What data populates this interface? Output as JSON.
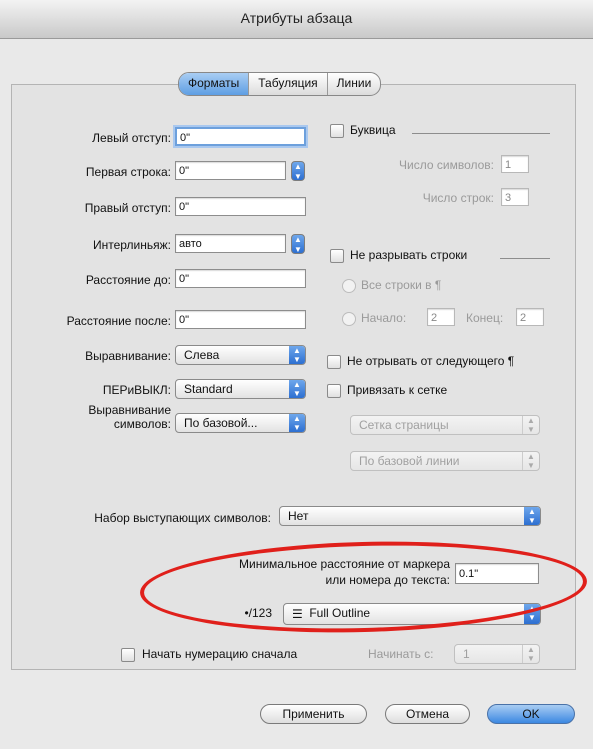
{
  "window": {
    "title": "Атрибуты абзаца"
  },
  "tabs": [
    {
      "label": "Форматы",
      "active": true
    },
    {
      "label": "Табуляция",
      "active": false
    },
    {
      "label": "Линии",
      "active": false
    }
  ],
  "fields": {
    "left_indent": {
      "label": "Левый отступ:",
      "value": "0\""
    },
    "first_line": {
      "label": "Первая строка:",
      "value": "0\""
    },
    "right_indent": {
      "label": "Правый отступ:",
      "value": "0\""
    },
    "leading": {
      "label": "Интерлиньяж:",
      "value": "авто"
    },
    "space_before": {
      "label": "Расстояние до:",
      "value": "0\""
    },
    "space_after": {
      "label": "Расстояние после:",
      "value": "0\""
    },
    "alignment": {
      "label": "Выравнивание:",
      "value": "Слева"
    },
    "hnj": {
      "label": "ПЕРиВЫКЛ:",
      "value": "Standard"
    },
    "char_align": {
      "label_line1": "Выравнивание",
      "label_line2": "символов:",
      "value": "По базовой..."
    },
    "hanging_chars": {
      "label": "Набор выступающих символов:",
      "value": "Нет"
    },
    "bullet_distance": {
      "label_line1": "Минимальное расстояние от маркера",
      "label_line2": "или номера до текста:",
      "value": "0.1\""
    },
    "numbering": {
      "label": "•/123",
      "value": "Full Outline"
    },
    "restart_numbering": {
      "label": "Начать нумерацию сначала"
    },
    "start_at": {
      "label": "Начинать с:",
      "value": "1"
    }
  },
  "drop_cap": {
    "label": "Буквица",
    "char_count_label": "Число символов:",
    "char_count": "1",
    "line_count_label": "Число строк:",
    "line_count": "3"
  },
  "keep_lines": {
    "label": "Не разрывать строки",
    "all_lines_label": "Все строки в ¶",
    "start_label": "Начало:",
    "start": "2",
    "end_label": "Конец:",
    "end": "2"
  },
  "keep_with_next": {
    "label": "Не отрывать от следующего ¶"
  },
  "lock_to_grid": {
    "label": "Привязать к сетке",
    "grid_type": "Сетка страницы",
    "baseline": "По базовой линии"
  },
  "buttons": {
    "apply": "Применить",
    "cancel": "Отмена",
    "ok": "OK"
  },
  "colors": {
    "accent": "#3c88e2",
    "annotation": "#e0201b"
  }
}
